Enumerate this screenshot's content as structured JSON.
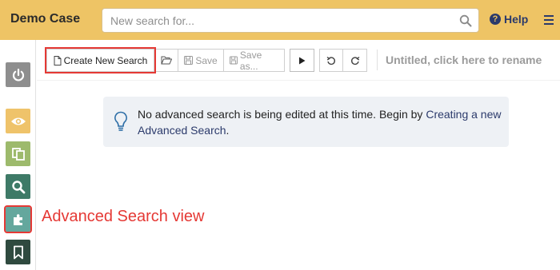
{
  "header": {
    "case_title": "Demo Case",
    "search_placeholder": "New search for...",
    "help_label": "Help",
    "icons": {
      "search": "magnifier-icon",
      "help": "question-circle-icon",
      "menu": "hamburger-icon"
    }
  },
  "sidebar": {
    "items": [
      {
        "icon": "power-icon",
        "color": "#8e8e8e"
      },
      {
        "icon": "eye-icon",
        "color": "#efc36a"
      },
      {
        "icon": "copy-icon",
        "color": "#9dba6c"
      },
      {
        "icon": "search-icon",
        "color": "#3e7a67"
      },
      {
        "icon": "puzzle-icon",
        "color": "#64a79d"
      },
      {
        "icon": "bookmark-icon",
        "color": "#2f4a3f"
      }
    ]
  },
  "annotation": {
    "text": "Advanced Search view",
    "color": "#e53935"
  },
  "toolbar": {
    "create_label": "Create New Search",
    "save_label": "Save",
    "save_as_label": "Save as...",
    "rename_label": "Untitled, click here to rename"
  },
  "info": {
    "text_before": "No advanced search is being edited at this time. Begin by ",
    "link_text": "Creating a new Advanced Search",
    "text_after": "."
  }
}
